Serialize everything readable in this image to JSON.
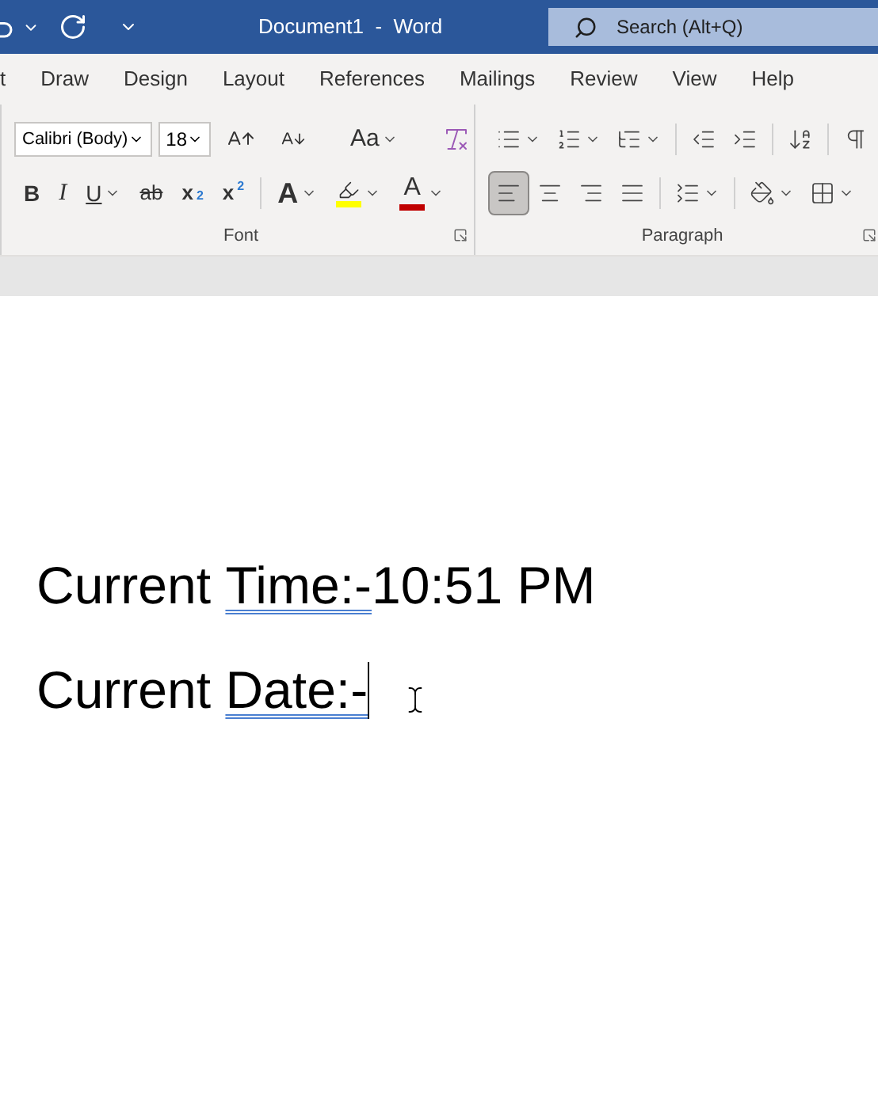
{
  "title_bar": {
    "title": "Document1  -  Word",
    "search": {
      "placeholder": "Search (Alt+Q)"
    }
  },
  "tabs": [
    {
      "label": "t",
      "selected": false
    },
    {
      "label": "Draw",
      "selected": false
    },
    {
      "label": "Design",
      "selected": false
    },
    {
      "label": "Layout",
      "selected": false
    },
    {
      "label": "References",
      "selected": false
    },
    {
      "label": "Mailings",
      "selected": false
    },
    {
      "label": "Review",
      "selected": false
    },
    {
      "label": "View",
      "selected": false
    },
    {
      "label": "Help",
      "selected": false
    }
  ],
  "font_group": {
    "label": "Font",
    "font_name": "Calibri (Body)",
    "font_size": "18",
    "row1": [
      {
        "kind": "grow"
      },
      {
        "kind": "shrink"
      },
      {
        "kind": "sep"
      },
      {
        "kind": "text",
        "label": "Aa",
        "dropdown": true
      },
      {
        "kind": "sep"
      },
      {
        "kind": "clear"
      }
    ],
    "row2": [
      {
        "kind": "bold",
        "label": "B"
      },
      {
        "kind": "italic",
        "label": "I"
      },
      {
        "kind": "underline",
        "label": "U",
        "dropdown": true
      },
      {
        "kind": "strike",
        "label": "ab"
      },
      {
        "kind": "sub",
        "label": "x",
        "sub": "2"
      },
      {
        "kind": "sup",
        "label": "x",
        "sup": "2"
      },
      {
        "kind": "sep"
      },
      {
        "kind": "effects",
        "label": "A",
        "dropdown": true
      },
      {
        "kind": "highlight",
        "dropdown": true,
        "color": "#ffff00"
      },
      {
        "kind": "fontcolor",
        "label": "A",
        "dropdown": true,
        "color": "#c00000"
      }
    ]
  },
  "paragraph_group": {
    "label": "Paragraph",
    "row1": [
      {
        "kind": "bullets",
        "dropdown": true
      },
      {
        "kind": "numbering",
        "dropdown": true
      },
      {
        "kind": "multilevel",
        "dropdown": true
      },
      {
        "kind": "sep"
      },
      {
        "kind": "outdent"
      },
      {
        "kind": "indent"
      },
      {
        "kind": "sep"
      },
      {
        "kind": "sort"
      },
      {
        "kind": "sep"
      },
      {
        "kind": "pilcrow"
      }
    ],
    "row2": [
      {
        "kind": "align-left",
        "selected": true
      },
      {
        "kind": "align-center",
        "selected": false
      },
      {
        "kind": "align-right",
        "selected": false
      },
      {
        "kind": "justify",
        "selected": false
      },
      {
        "kind": "sep"
      },
      {
        "kind": "spacing",
        "dropdown": true
      },
      {
        "kind": "sep"
      },
      {
        "kind": "shading",
        "dropdown": true
      },
      {
        "kind": "borders",
        "dropdown": true
      }
    ]
  },
  "document": {
    "lines": [
      {
        "parts": [
          {
            "text": "Current "
          },
          {
            "text": "Time:-",
            "flagged": true
          },
          {
            "text": "10:51 PM"
          }
        ]
      },
      {
        "parts": [
          {
            "text": "Current "
          },
          {
            "text": "Date:-",
            "flagged": true
          }
        ],
        "cursor": true
      }
    ]
  }
}
